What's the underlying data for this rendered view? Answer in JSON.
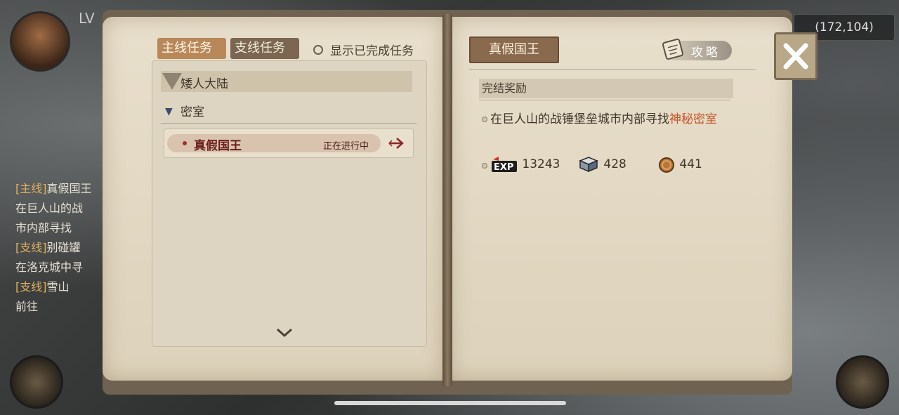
{
  "hud": {
    "level_label": "LV",
    "coordinates": "(172,104)"
  },
  "side_log": [
    {
      "tag": "[主线]",
      "text": "真假国王"
    },
    {
      "tag": "",
      "text": "在巨人山的战"
    },
    {
      "tag": "",
      "text": "市内部寻找"
    },
    {
      "tag": "[支线]",
      "text": "别碰罐"
    },
    {
      "tag": "",
      "text": "在洛克城中寻"
    },
    {
      "tag": "[支线]",
      "text": "雪山"
    },
    {
      "tag": "",
      "text": "前往"
    }
  ],
  "tabs": {
    "main_label": "主线任务",
    "side_label": "支线任务",
    "show_completed_label": "显示已完成任务"
  },
  "quest_list": {
    "region": "矮人大陆",
    "category": "密室",
    "quests": [
      {
        "name": "真假国王",
        "status": "正在进行中"
      }
    ]
  },
  "detail": {
    "title": "真假国王",
    "guide_label": "攻略",
    "reward_header": "完结奖励",
    "desc_prefix": "在巨人山的战锤堡垒城市内部寻找",
    "desc_highlight": "神秘密室",
    "rewards": {
      "exp": "13243",
      "crystal": "428",
      "coin": "441"
    }
  },
  "colors": {
    "highlight": "#c4542a",
    "quest_name": "#6b1d1d"
  }
}
